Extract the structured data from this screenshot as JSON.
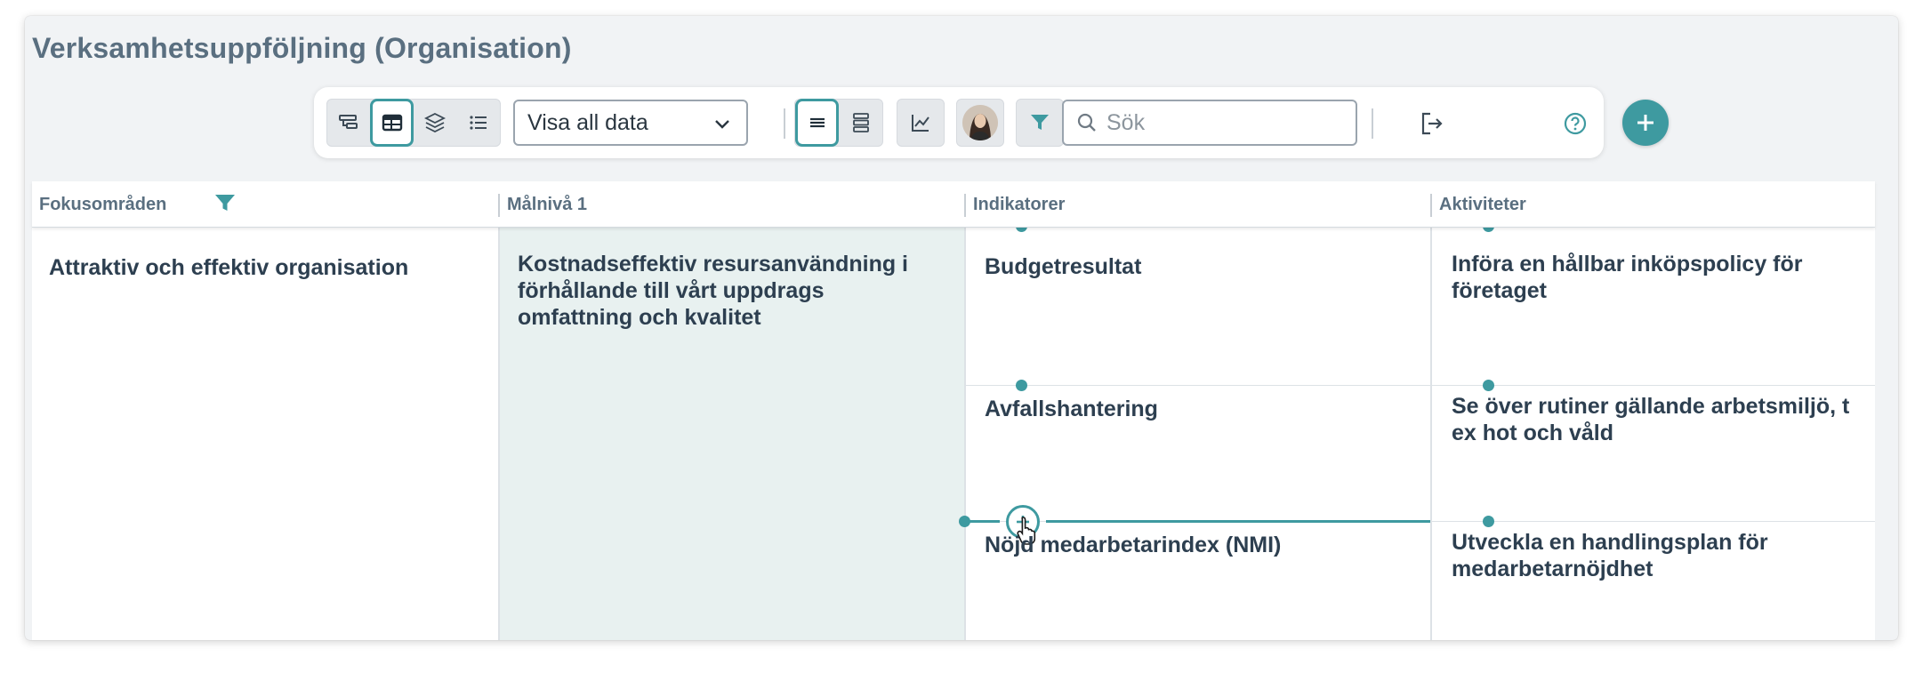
{
  "page": {
    "title": "Verksamhetsuppföljning (Organisation)"
  },
  "toolbar": {
    "view_select": {
      "value": "Visa all data",
      "options": [
        "Visa all data"
      ]
    },
    "search": {
      "placeholder": "Sök",
      "value": ""
    },
    "icons": {
      "view_tree": "tree-view-icon",
      "view_table": "table-view-icon",
      "view_layers": "layers-view-icon",
      "view_list": "list-view-icon",
      "density_compact": "compact-rows-icon",
      "density_expanded": "expanded-rows-icon",
      "chart": "line-chart-icon",
      "user": "user-avatar",
      "filter": "filter-icon",
      "search": "search-icon",
      "export": "export-icon",
      "help": "help-icon",
      "add": "plus-icon"
    },
    "active": [
      "table-view",
      "compact-rows"
    ]
  },
  "columns": {
    "focus": "Fokusområden",
    "goal": "Målnivå 1",
    "indicators": "Indikatorer",
    "activities": "Aktiviteter"
  },
  "rows": {
    "focus_area": "Attraktiv och effektiv organisation",
    "goal_lines": [
      "Kostnadseffektiv resursanvändning i",
      "förhållande till vårt uppdrags",
      "omfattning och kvalitet"
    ],
    "indicators": [
      "Budgetresultat",
      "Avfallshantering",
      "Nöjd medarbetarindex (NMI)"
    ],
    "activities": [
      [
        "Införa en hållbar inköpspolicy för",
        "företaget"
      ],
      [
        "Se över rutiner gällande arbetsmiljö, t",
        "ex hot och våld"
      ],
      [
        "Utveckla en handlingsplan för",
        "medarbetarnöjdhet"
      ]
    ]
  },
  "colors": {
    "accent": "#3e9aa0",
    "title": "#5a6f80",
    "text": "#2d3f50",
    "goal_bg": "#e8f1f0"
  }
}
